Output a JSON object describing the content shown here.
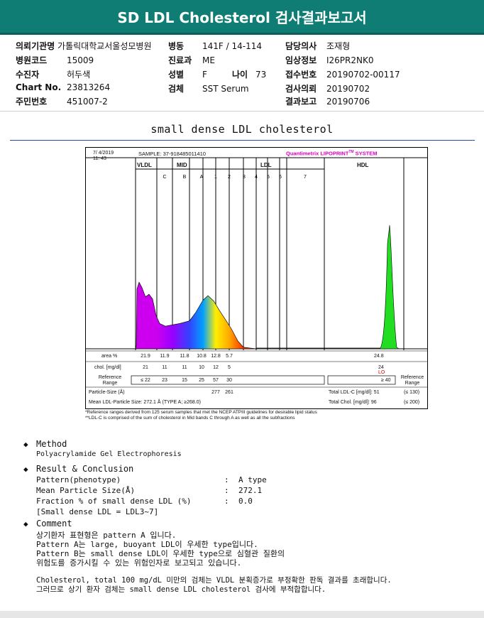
{
  "title": "SD LDL Cholesterol 검사결과보고서",
  "info": {
    "col1": [
      {
        "label": "의뢰기관명",
        "value": "가톨릭대학교서울성모병원"
      },
      {
        "label": "병원코드",
        "value": "15009"
      },
      {
        "label": "수진자",
        "value": "허두색"
      },
      {
        "label": "Chart No.",
        "value": "23813264"
      },
      {
        "label": "주민번호",
        "value": "451007-2"
      }
    ],
    "col2": [
      {
        "label": "병동",
        "value": "141F / 14-114"
      },
      {
        "label": "진료과",
        "value": "ME"
      },
      {
        "label": "성별",
        "value": "F"
      },
      {
        "label": "검체",
        "value": "SST Serum"
      }
    ],
    "age_label": "나이",
    "age_value": "73",
    "col3": [
      {
        "label": "담당의사",
        "value": "조재형"
      },
      {
        "label": "임상정보",
        "value": "I26PR2NK0"
      },
      {
        "label": "접수번호",
        "value": "20190702-00117"
      },
      {
        "label": "검사의뢰",
        "value": "20190702"
      },
      {
        "label": "결과보고",
        "value": "20190706"
      }
    ]
  },
  "chart_title": "small dense LDL cholesterol",
  "chart_data": {
    "type": "area",
    "date": "7/ 4/2019",
    "time": "11: 43",
    "sample": "SAMPLE:  37-918485011410",
    "brand": "Quantimetrix LIPOPRINT",
    "brand_tm": "TM",
    "brand_suffix": " SYSTEM",
    "groups": {
      "vldl": "VLDL",
      "mid": "MID",
      "ldl": "LDL",
      "hdl": "HDL"
    },
    "bands": [
      "C",
      "B",
      "A",
      "1",
      "2",
      "3",
      "4",
      "5",
      "6",
      "7"
    ],
    "band_colors": [
      "#cc00ee",
      "#9900ff",
      "#3344ff",
      "#00a0ff",
      "#ffee00",
      "#ffaa00",
      "#ff3300",
      "#ff0000",
      "#cc0000",
      "#cc0000"
    ],
    "vldl_color": "#cc00ee",
    "hdl_color": "#22dd22",
    "row_labels": {
      "area": "area %",
      "chol": "chol. [mg/dl]",
      "ref": "Reference Range",
      "size": "Particle-Size (Å)",
      "mean": "Mean LDL-Particle Size:  272.1 Å  (TYPE A; ≥268.0)"
    },
    "area": [
      "21.9",
      "11.9",
      "11.8",
      "10.8",
      "12.8",
      "5.7"
    ],
    "area_hdl": "24.8",
    "chol": [
      "21",
      "11",
      "11",
      "10",
      "12",
      "5"
    ],
    "chol_hdl": "24",
    "hdl_flag": "LO",
    "ref": [
      "≤ 22",
      "23",
      "15",
      "25",
      "57",
      "30"
    ],
    "ref_hdl": "≥ 40",
    "ref_right": "Reference Range",
    "size": [
      "277",
      "261"
    ],
    "total_ldl": "Total LDL-C [mg/dl]:  51",
    "total_ldl_ref": "(≤ 130)",
    "total_chol": "Total Chol. [mg/dl]:   96",
    "total_chol_ref": "(≤ 200)",
    "vldl_peak": 0.42,
    "hdl_peak": 0.78
  },
  "footnotes": [
    "*Reference ranges derived from 125 serum samples that met the NCEP ATPIII guidelines for desirable lipid status",
    "**LDL-C is comprised of the sum of cholesterol in Mid bands C through A as well as all the subfractions"
  ],
  "method": {
    "heading": "Method",
    "text": "Polyacrylamide Gel Electrophoresis"
  },
  "result": {
    "heading": "Result & Conclusion",
    "rows": [
      {
        "label": "Pattern(phenotype)",
        "sep": ":",
        "value": "A type"
      },
      {
        "label": "Mean Particle Size(Å)",
        "sep": ":",
        "value": "272.1"
      },
      {
        "label": "Fraction % of small dense LDL (%)",
        "sep": ":",
        "value": "0.0"
      }
    ],
    "note": "[Small dense LDL = LDL3~7]"
  },
  "comment": {
    "heading": "Comment",
    "lines": [
      "상기환자 표현형은 pattern A 입니다.",
      "Pattern A는 large, buoyant LDL이 우세한 type입니다.",
      "Pattern B는 small dense LDL이 우세한 type으로 심혈관 질환의",
      "위험도를 증가시킬 수 있는 위험인자로 보고되고 있습니다.",
      "",
      "Cholesterol, total 100 mg/dL 미만의 검체는 VLDL 분획증가로 부정확한 판독 결과를 초래합니다.",
      "그러므로 상기 환자 검체는 small dense LDL cholesterol 검사에 부적합합니다."
    ]
  }
}
